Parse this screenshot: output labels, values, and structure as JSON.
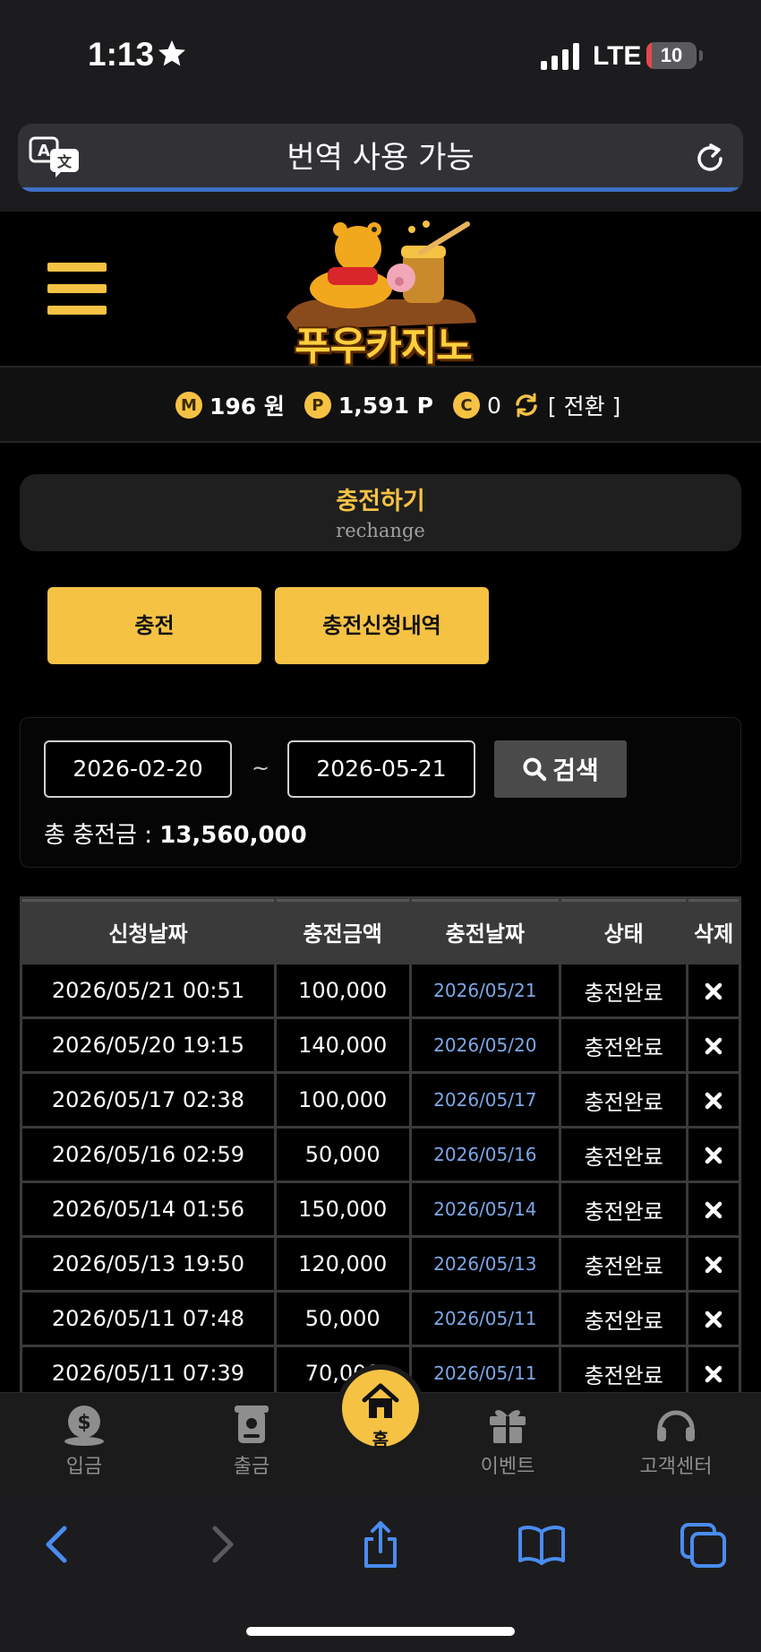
{
  "status_bar": {
    "time": "1:13",
    "network": "LTE",
    "battery_level": "10",
    "battery_fraction": 0.1,
    "battery_color": "#e5484d"
  },
  "browser": {
    "url_text": "번역 사용 가능"
  },
  "site": {
    "logo_text": "푸우카지노",
    "accent_color": "#f6c244"
  },
  "balance": {
    "money_icon": "M",
    "money": "196 원",
    "point_icon": "P",
    "points": "1,591 P",
    "coin_icon": "C",
    "coins": "0",
    "convert_label": "[ 전환 ]"
  },
  "page_title": {
    "main": "충전하기",
    "sub": "rechange"
  },
  "tabs": {
    "charge": "충전",
    "history": "충전신청내역"
  },
  "search": {
    "date_from": "2026-02-20",
    "separator": "~",
    "date_to": "2026-05-21",
    "button_label": "검색",
    "total_label": "총 충전금 : ",
    "total_value": "13,560,000"
  },
  "table": {
    "headers": [
      "신청날짜",
      "충전금액",
      "충전날짜",
      "상태",
      "삭제"
    ],
    "rows": [
      {
        "request_date": "2026/05/21 00:51",
        "amount": "100,000",
        "charge_date": "2026/05/21",
        "status": "충전완료"
      },
      {
        "request_date": "2026/05/20 19:15",
        "amount": "140,000",
        "charge_date": "2026/05/20",
        "status": "충전완료"
      },
      {
        "request_date": "2026/05/17 02:38",
        "amount": "100,000",
        "charge_date": "2026/05/17",
        "status": "충전완료"
      },
      {
        "request_date": "2026/05/16 02:59",
        "amount": "50,000",
        "charge_date": "2026/05/16",
        "status": "충전완료"
      },
      {
        "request_date": "2026/05/14 01:56",
        "amount": "150,000",
        "charge_date": "2026/05/14",
        "status": "충전완료"
      },
      {
        "request_date": "2026/05/13 19:50",
        "amount": "120,000",
        "charge_date": "2026/05/13",
        "status": "충전완료"
      },
      {
        "request_date": "2026/05/11 07:48",
        "amount": "50,000",
        "charge_date": "2026/05/11",
        "status": "충전완료"
      },
      {
        "request_date": "2026/05/11 07:39",
        "amount": "70,000",
        "charge_date": "2026/05/11",
        "status": "충전완료"
      }
    ]
  },
  "bottom_nav": {
    "deposit": "입금",
    "withdraw": "출금",
    "home": "홈",
    "event": "이벤트",
    "support": "고객센터"
  }
}
